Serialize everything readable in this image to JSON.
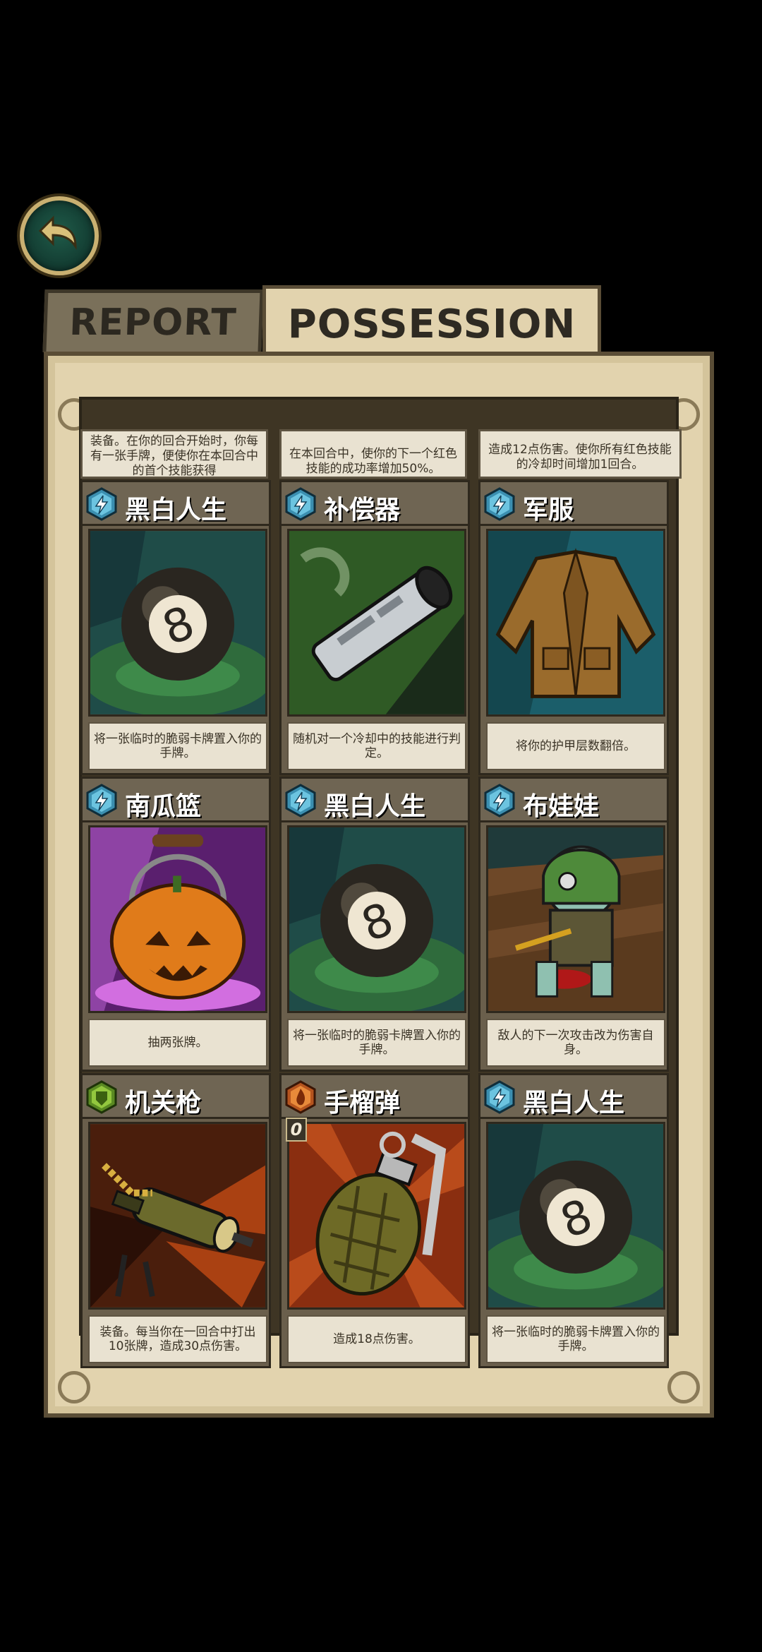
{
  "tabs": {
    "report_label": "REPORT",
    "possession_label": "POSSESSION"
  },
  "top_strip": [
    "装备。在你的回合开始时，你每有一张手牌，便使你在本回合中的首个技能获得",
    "在本回合中，使你的下一个红色技能的成功率增加50%。",
    "造成12点伤害。使你所有红色技能的冷却时间增加1回合。"
  ],
  "cards": [
    {
      "name": "黑白人生",
      "badge": "blue-lightning-icon",
      "cost": "",
      "desc": "将一张临时的脆弱卡牌置入你的手牌。",
      "art": "eight-ball"
    },
    {
      "name": "补偿器",
      "badge": "blue-lightning-icon",
      "cost": "",
      "desc": "随机对一个冷却中的技能进行判定。",
      "art": "compensator"
    },
    {
      "name": "军服",
      "badge": "blue-lightning-icon",
      "cost": "",
      "desc": "将你的护甲层数翻倍。",
      "art": "uniform"
    },
    {
      "name": "南瓜篮",
      "badge": "blue-lightning-icon",
      "cost": "",
      "desc": "抽两张牌。",
      "art": "pumpkin"
    },
    {
      "name": "黑白人生",
      "badge": "blue-lightning-icon",
      "cost": "",
      "desc": "将一张临时的脆弱卡牌置入你的手牌。",
      "art": "eight-ball"
    },
    {
      "name": "布娃娃",
      "badge": "blue-lightning-icon",
      "cost": "",
      "desc": "敌人的下一次攻击改为伤害自身。",
      "art": "doll"
    },
    {
      "name": "机关枪",
      "badge": "green-shield-icon",
      "cost": "",
      "desc": "装备。每当你在一回合中打出10张牌，造成30点伤害。",
      "art": "machine-gun"
    },
    {
      "name": "手榴弹",
      "badge": "orange-fire-icon",
      "cost": "0",
      "desc": "造成18点伤害。",
      "art": "grenade"
    },
    {
      "name": "黑白人生",
      "badge": "blue-lightning-icon",
      "cost": "",
      "desc": "将一张临时的脆弱卡牌置入你的手牌。",
      "art": "eight-ball"
    }
  ]
}
